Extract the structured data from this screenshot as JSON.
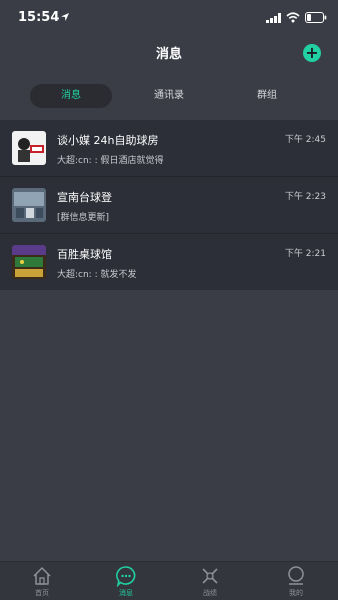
{
  "status_bar": {
    "time": "15:54"
  },
  "nav": {
    "title": "消息",
    "add_label": "+"
  },
  "tabs": [
    {
      "label": "消息",
      "active": true
    },
    {
      "label": "通讯录",
      "active": false
    },
    {
      "label": "群组",
      "active": false
    }
  ],
  "conversations": [
    {
      "name": "谈小媒 24h自助球房",
      "time": "下午 2:45",
      "preview": "大超:cn: : 假日酒店就觉得"
    },
    {
      "name": "宣南台球登",
      "time": "下午 2:23",
      "preview": "[群信息更新]"
    },
    {
      "name": "百胜桌球馆",
      "time": "下午 2:21",
      "preview": "大超:cn: : 就发不发"
    }
  ],
  "tabbar": [
    {
      "label": "首页",
      "icon": "home-icon",
      "active": false
    },
    {
      "label": "消息",
      "icon": "chat-icon",
      "active": true
    },
    {
      "label": "战绩",
      "icon": "cue-icon",
      "active": false
    },
    {
      "label": "我的",
      "icon": "profile-icon",
      "active": false
    }
  ],
  "colors": {
    "accent": "#21d0a3",
    "background": "#3a3d45",
    "list_bg": "#2c2f37"
  }
}
